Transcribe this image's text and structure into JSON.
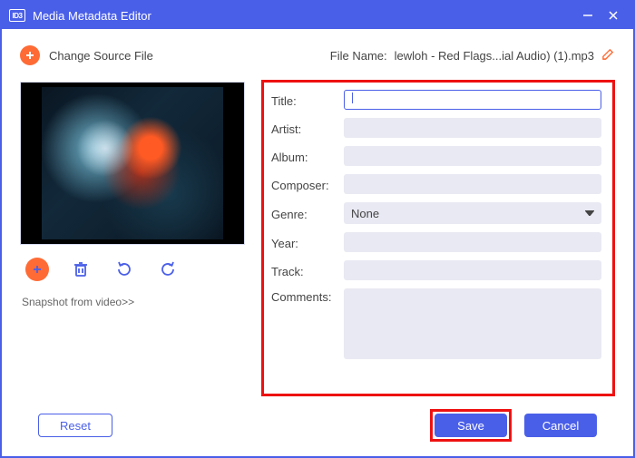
{
  "window": {
    "title": "Media Metadata Editor"
  },
  "toprow": {
    "change_source_label": "Change Source File",
    "file_name_label": "File Name:",
    "file_name_value": "lewloh - Red Flags...ial Audio) (1).mp3"
  },
  "left": {
    "snapshot_link": "Snapshot from video>>"
  },
  "form": {
    "title_label": "Title:",
    "title_value": "",
    "artist_label": "Artist:",
    "artist_value": "",
    "album_label": "Album:",
    "album_value": "",
    "composer_label": "Composer:",
    "composer_value": "",
    "genre_label": "Genre:",
    "genre_value": "None",
    "year_label": "Year:",
    "year_value": "",
    "track_label": "Track:",
    "track_value": "",
    "comments_label": "Comments:",
    "comments_value": ""
  },
  "footer": {
    "reset_label": "Reset",
    "save_label": "Save",
    "cancel_label": "Cancel"
  },
  "icons": {
    "logo_text": "ID3"
  }
}
